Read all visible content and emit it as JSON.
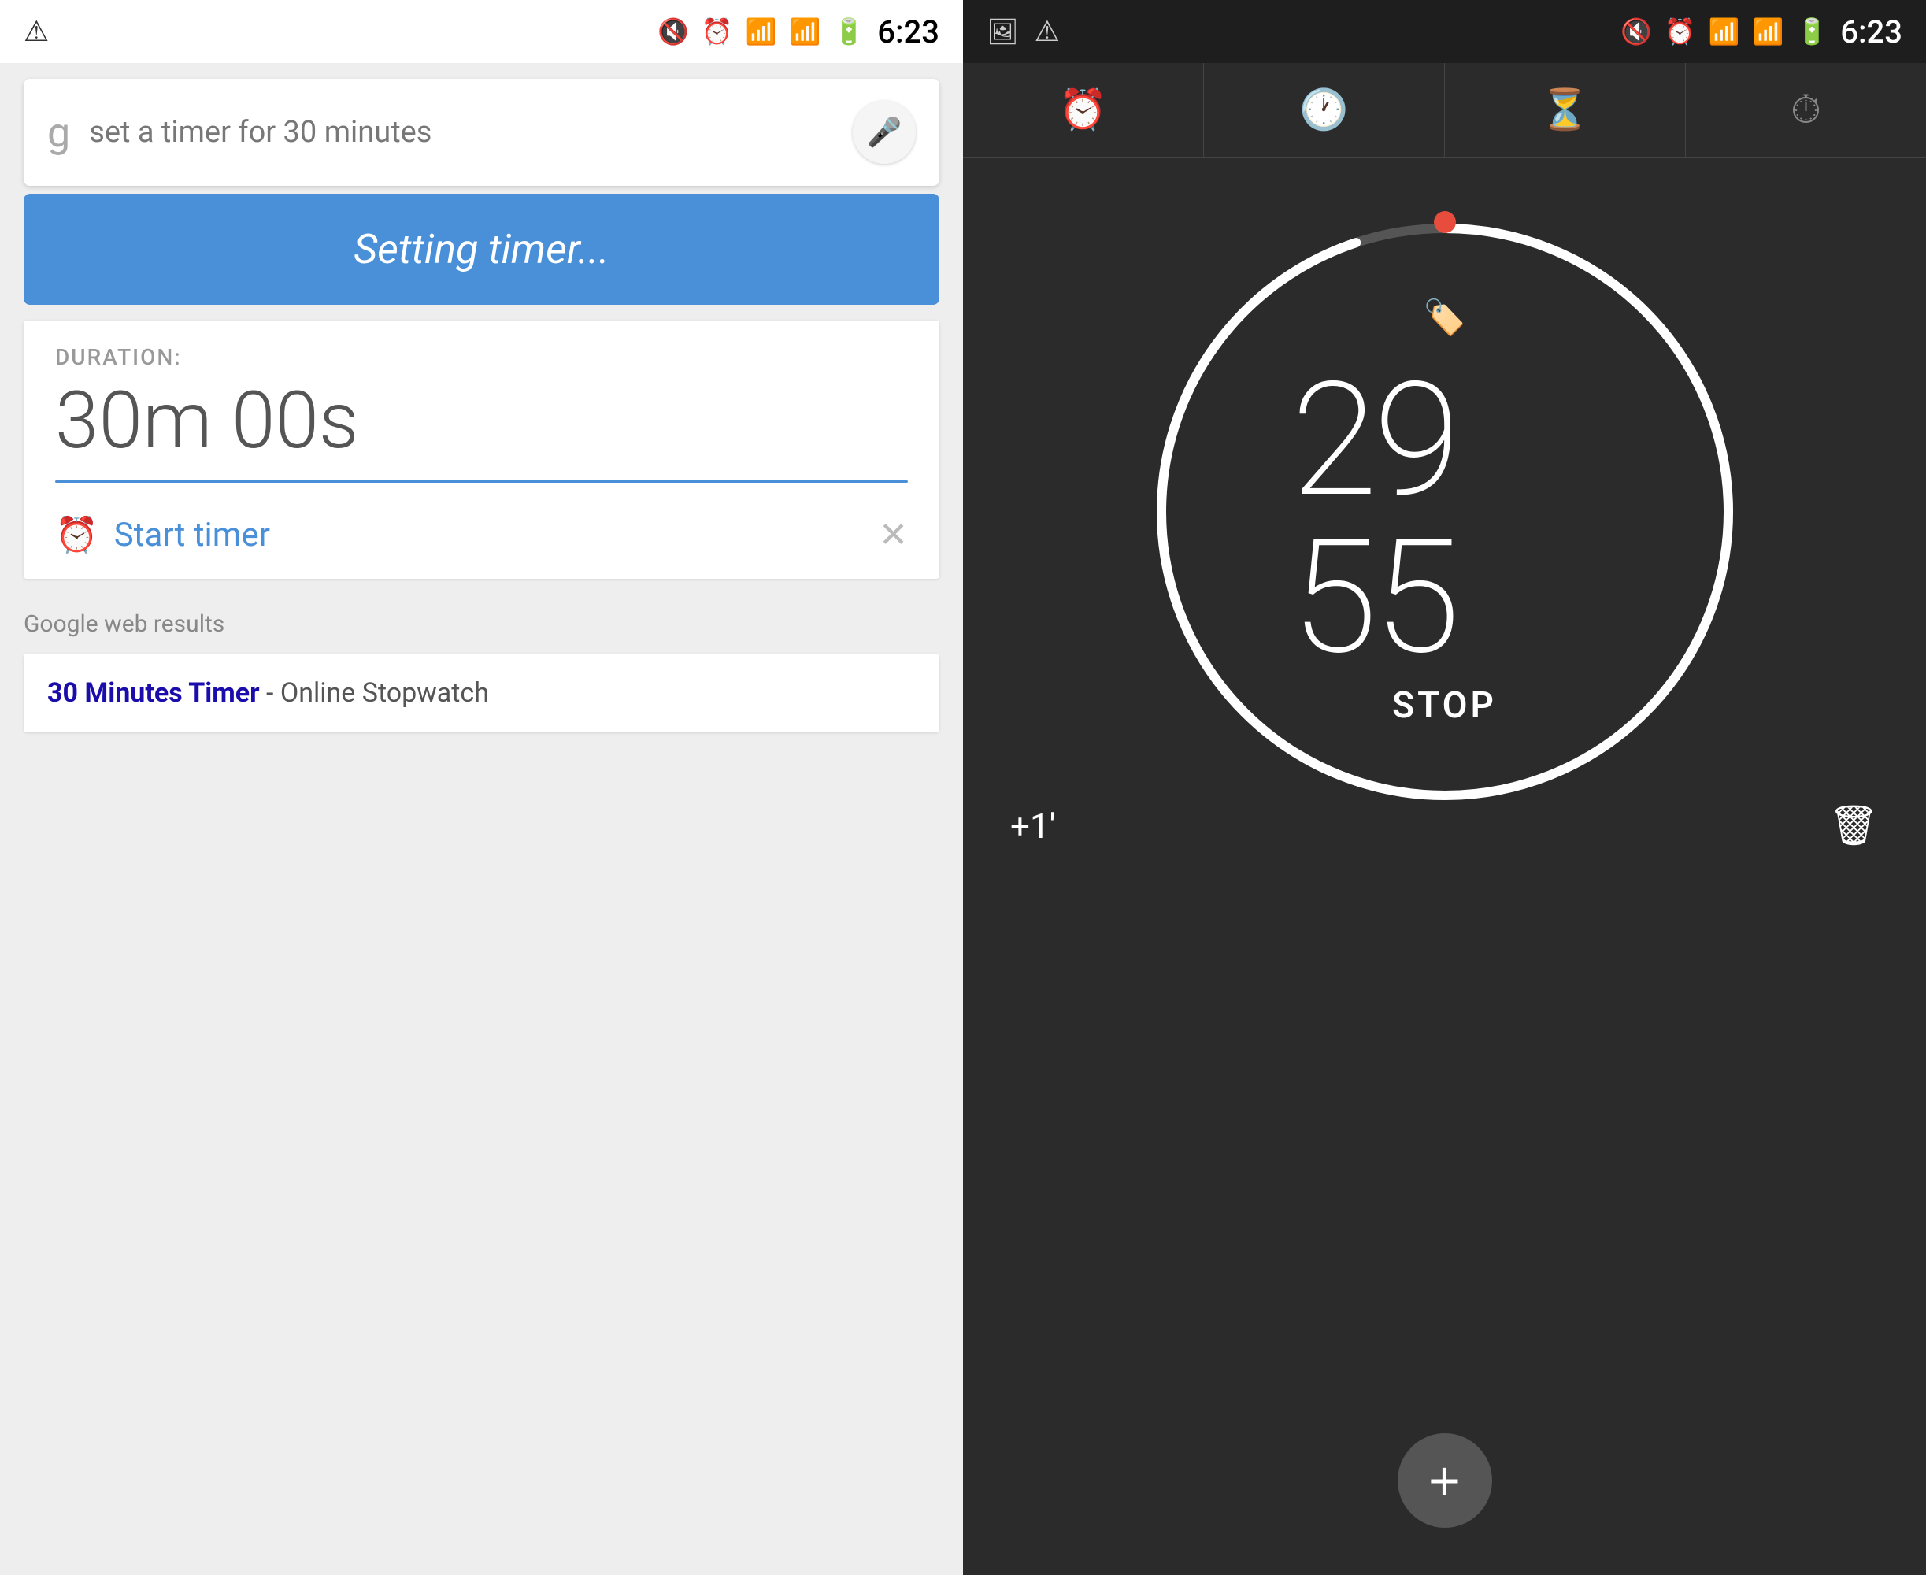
{
  "left": {
    "status_bar": {
      "time": "6:23",
      "warning": "⚠",
      "mute_icon": "🔇",
      "alarm_icon": "⏰",
      "wifi_icon": "📶",
      "signal_icon": "📶",
      "battery_icon": "🔋"
    },
    "search": {
      "google_logo": "g",
      "query": "set a timer for 30 minutes",
      "mic_label": "🎤"
    },
    "banner": {
      "text": "Setting timer..."
    },
    "timer_card": {
      "duration_label": "DURATION:",
      "duration_value": "30m 00s",
      "start_timer_label": "Start timer",
      "alarm_icon": "⏰",
      "close_icon": "✕"
    },
    "web_results": {
      "section_label": "Google web results",
      "result_title_bold": "30 Minutes Timer",
      "result_title_dash": " - Online Stopwatch"
    }
  },
  "right": {
    "status_bar": {
      "time": "6:23",
      "warning": "⚠",
      "photo_icon": "🖼",
      "mute_icon": "🔇",
      "alarm_icon": "⏰",
      "wifi_icon": "📶",
      "signal_icon": "📶",
      "battery_icon": "🔋"
    },
    "tabs": [
      {
        "icon": "⏰",
        "label": "alarm",
        "active": false
      },
      {
        "icon": "🕐",
        "label": "clock",
        "active": false
      },
      {
        "icon": "⏳",
        "label": "timer",
        "active": true
      },
      {
        "icon": "⏱",
        "label": "stopwatch",
        "active": false
      }
    ],
    "timer": {
      "time_display": "29 55",
      "stop_label": "STOP",
      "label_icon": "🏷",
      "plus_one": "+1'",
      "delete_icon": "🗑",
      "add_icon": "+"
    }
  }
}
